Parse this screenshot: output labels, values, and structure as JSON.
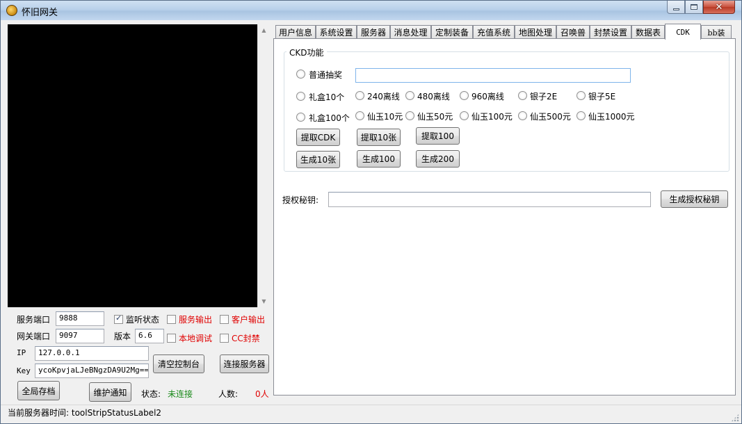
{
  "window": {
    "title": "怀旧网关"
  },
  "left_panel": {
    "service_port_label": "服务端口",
    "service_port_value": "9888",
    "listen_status_label": "监听状态",
    "listen_status_checked": true,
    "service_output_label": "服务输出",
    "client_output_label": "客户输出",
    "gateway_port_label": "网关端口",
    "gateway_port_value": "9097",
    "version_label": "版本",
    "version_value": "6.6",
    "local_debug_label": "本地调试",
    "cc_ban_label": "CC封禁",
    "ip_label": "IP",
    "ip_value": "127.0.0.1",
    "key_label": "Key",
    "key_value": "ycoKpvjaLJeBNgzDA9U2Mg==",
    "clear_console_button": "清空控制台",
    "connect_server_button": "连接服务器",
    "global_save_button": "全局存档",
    "maintenance_notice_button": "维护通知",
    "status_label": "状态:",
    "status_value": "未连接",
    "people_label": "人数:",
    "people_value": "0人"
  },
  "tabs": [
    {
      "label": "用户信息"
    },
    {
      "label": "系统设置"
    },
    {
      "label": "服务器"
    },
    {
      "label": "消息处理"
    },
    {
      "label": "定制装备"
    },
    {
      "label": "充值系统"
    },
    {
      "label": "地图处理"
    },
    {
      "label": "召唤兽"
    },
    {
      "label": "封禁设置"
    },
    {
      "label": "数据表"
    },
    {
      "label": "CDK"
    },
    {
      "label": "bb装"
    }
  ],
  "active_tab": "CDK",
  "cdk": {
    "group_title": "CKD功能",
    "radio_normal_draw": "普通抽奖",
    "normal_draw_input": "",
    "row2": [
      "礼盒10个",
      "240离线",
      "480离线",
      "960离线",
      "银子2E",
      "银子5E"
    ],
    "row3": [
      "礼盒100个",
      "仙玉10元",
      "仙玉50元",
      "仙玉100元",
      "仙玉500元",
      "仙玉1000元"
    ],
    "buttons_row1": [
      "提取CDK",
      "提取10张",
      "提取100"
    ],
    "buttons_row2": [
      "生成10张",
      "生成100",
      "生成200"
    ],
    "auth_key_label": "授权秘钥:",
    "auth_key_value": "",
    "generate_auth_key_button": "生成授权秘钥"
  },
  "statusbar": {
    "text": "当前服务器时间:  toolStripStatusLabel2"
  }
}
